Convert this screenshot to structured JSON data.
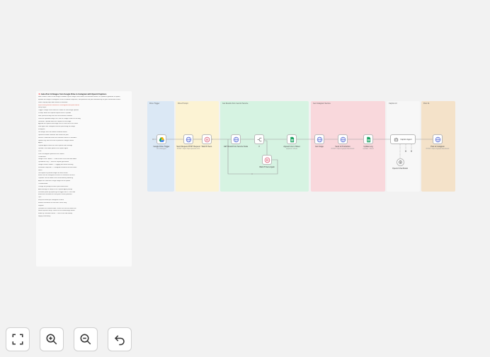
{
  "note": {
    "title": "🧠 Auto-Post AI Images from Google Drive to Instagram with OpenAI Captions",
    "lines": [
      "How it works: When a new image is added to your Google Drive folder, this workflow sends it to OpenAI to generate a caption,",
      "uploads the image to Instagram via the Facebook Graph API, and publishes the post automatically on your connected account.",
      "Watch step-by-step video tutorial of workflow:",
      "https://www.youtube.com/watch?v=instagram-auto-post-tutorial",
      "Setup steps:",
      "Trigger: Google Drive watches a folder for new image uploads",
      "Prompt: builds the caption request sent to OpenAI",
      "Wait: pauses briefly while the file becomes available",
      "Load the uploaded image URL into the Google Sheet for tracking",
      "Generate: OpenAI writes the caption for the image",
      "Append the caption and image link as a new row in the sheet",
      "Wait again until Instagram finishes processing the image",
      "Instagram:",
      "Get image: fetch the media container details",
      "Upload to media container and create the post",
      "Send to Production when the container status is FINISHED",
      "Update Log: mark the row as posted in Google Sheets",
      "Agent:",
      "Caption Agent refines the final caption and hashtags",
      "OpenAI Chat Model powers the caption agent",
      "Post:",
      "Post to Instagram publishes the content",
      "Credentials:",
      "Google Drive OAuth2 — read access to the watched folder",
      "OpenAI API key — used for caption generation",
      "Google Sheets OAuth2 — logging and status tracking",
      "Facebook Graph API — Instagram Business account token",
      "Notes:",
      "Use square or portrait images for best results",
      "Make sure the Instagram account is a Business account",
      "Captions can be edited in the sheet before publishing",
      "Adjust the Wait time if large images fail to upload",
      "Customization:",
      "Change the prompt to match your brand voice",
      "Add hashtags or emojis in the Caption Agent prompt",
      "Schedule posts by replacing the trigger with a Cron node",
      "Extend the workflow to cross-post to other platforms",
      "Tips:",
      "Keep one folder per Instagram account",
      "Monitor executions to catch API errors early",
      "Support:",
      "Questions or custom builds? Reach out via the tutorial link",
      "Need help with setup? Watch the full walkthrough above",
      "Made by: Workflow author — free to use and modify",
      "Happy automating!"
    ]
  },
  "zones": {
    "trigger": "Drive Trigger",
    "prompt": "Drive Prompt",
    "generate": "Get Results from Gemini Service",
    "instagram": "Get Instagram Service",
    "agent": "Caption AI",
    "post": "Post IG"
  },
  "nodes": {
    "drive_trigger": {
      "label": "Google Drive Trigger",
      "sub": "On changes"
    },
    "prompt": {
      "label": "Send Request POST Request",
      "sub": "POST: https://api.openai.com"
    },
    "wait1": {
      "label": "Wait 15 Secs",
      "sub": ""
    },
    "get_result": {
      "label": "GET Result from Service Node",
      "sub": ""
    },
    "if": {
      "label": "If",
      "sub": ""
    },
    "wait2": {
      "label": "Wait 15 Secs Again",
      "sub": ""
    },
    "append": {
      "label": "Append row in Sheet",
      "sub": "append: sheet"
    },
    "get_image": {
      "label": "Get Image",
      "sub": ""
    },
    "send_prod": {
      "label": "Send to Production",
      "sub": "POST: https://graph.facebook"
    },
    "update_log": {
      "label": "Update Log",
      "sub": "update: sheet"
    },
    "caption_agent": {
      "label": "Caption Agent",
      "sub": ""
    },
    "chat_model": {
      "label": "OpenAI Chat Model",
      "sub": ""
    },
    "post_ig": {
      "label": "Post to Instagram",
      "sub": "POST: https://graph.facebook"
    }
  },
  "colors": {
    "trigger_zone": "#dbe8f5",
    "prompt_zone": "#fcf3d4",
    "generate_zone": "#d6f3e2",
    "instagram_zone": "#f9d8dc",
    "post_zone": "#f4e2c9",
    "http_blue": "#5b6fd6",
    "sheets_green": "#1ea363",
    "wait_red": "#d94f6a"
  },
  "toolbar": {
    "fit": "fit-view-icon",
    "zoom_in": "zoom-in-icon",
    "zoom_out": "zoom-out-icon",
    "reset": "undo-icon"
  }
}
